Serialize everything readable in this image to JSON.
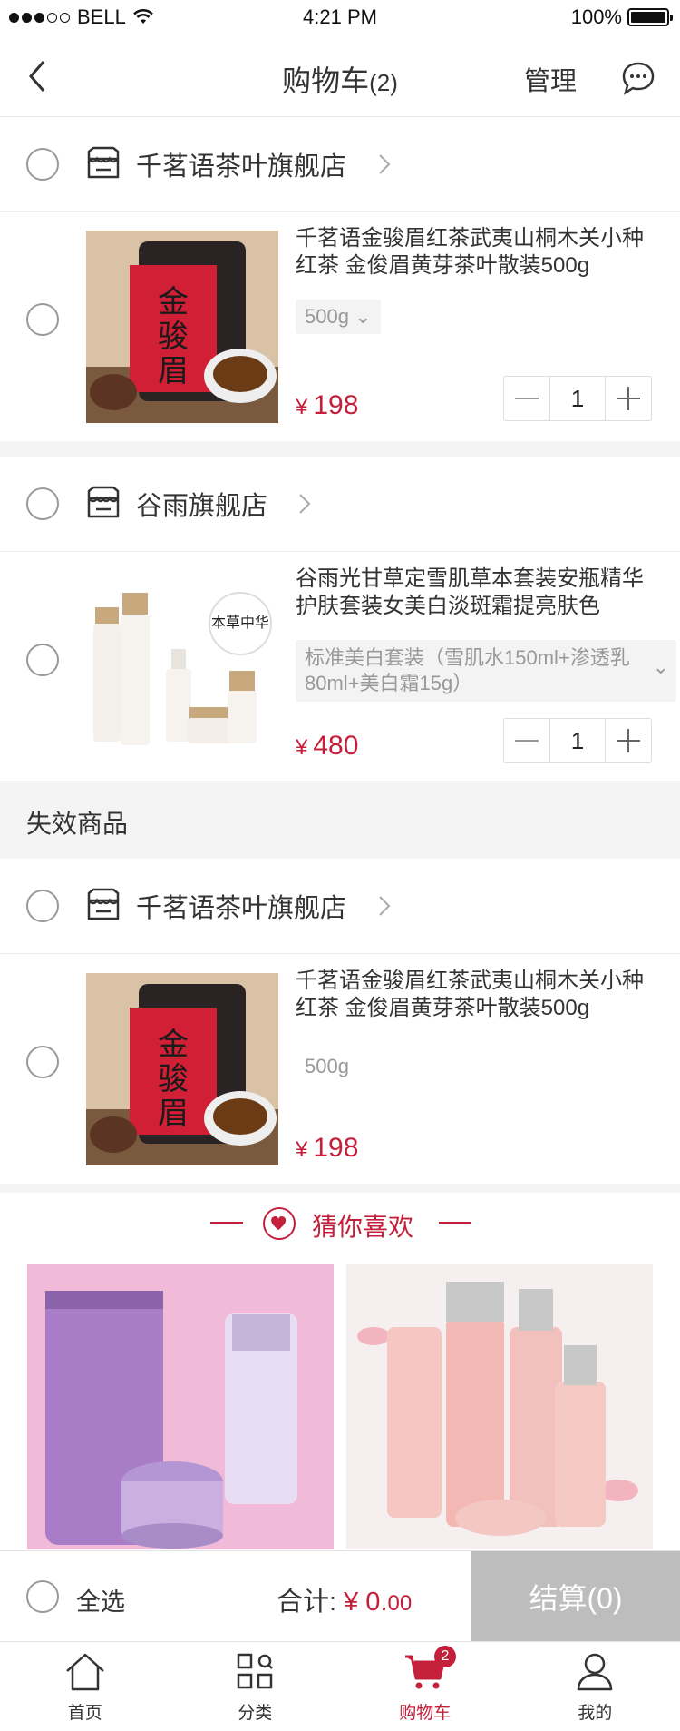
{
  "status": {
    "carrier": "BELL",
    "time": "4:21 PM",
    "battery": "100%"
  },
  "nav": {
    "title": "购物车",
    "count": "(2)",
    "manage": "管理"
  },
  "shops": [
    {
      "name": "千茗语茶叶旗舰店",
      "item": {
        "name": "千茗语金骏眉红茶武夷山桐木关小种红茶 金俊眉黄芽茶叶散装500g",
        "spec": "500g",
        "price": "198",
        "qty": "1"
      }
    },
    {
      "name": "谷雨旗舰店",
      "item": {
        "name": "谷雨光甘草定雪肌草本套装安瓶精华护肤套装女美白淡斑霜提亮肤色",
        "spec": "标准美白套装（雪肌水150ml+渗透乳80ml+美白霜15g）",
        "price": "480",
        "qty": "1"
      }
    }
  ],
  "invalid": {
    "title": "失效商品",
    "shop": "千茗语茶叶旗舰店",
    "item": {
      "name": "千茗语金骏眉红茶武夷山桐木关小种红茶 金俊眉黄芽茶叶散装500g",
      "spec": "500g",
      "price": "198"
    }
  },
  "guess": {
    "title": "猜你喜欢"
  },
  "currency": "¥",
  "bottom": {
    "select_all": "全选",
    "total_label": "合计:",
    "total_int": "¥ 0.",
    "total_dec": "00",
    "checkout": "结算(0)"
  },
  "tabs": [
    {
      "label": "首页",
      "icon": "home-icon"
    },
    {
      "label": "分类",
      "icon": "category-icon"
    },
    {
      "label": "购物车",
      "icon": "cart-icon",
      "badge": "2"
    },
    {
      "label": "我的",
      "icon": "user-icon"
    }
  ],
  "colors": {
    "accent": "#c4203b",
    "divider": "#f4f4f4"
  }
}
